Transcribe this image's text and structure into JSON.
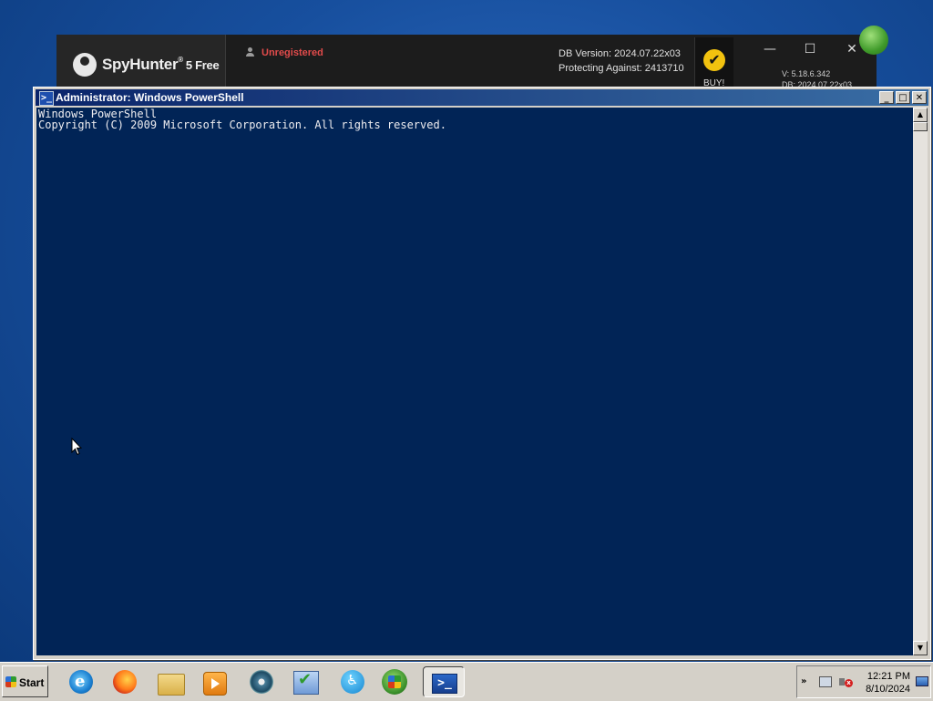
{
  "spyhunter": {
    "logo_name": "SpyHunter",
    "logo_reg": "®",
    "logo_edition": "5 Free",
    "user_status": "Unregistered",
    "db_version": "DB Version: 2024.07.22x03",
    "protecting_against": "Protecting Against: 2413710",
    "buy_label": "BUY!",
    "buy_icon": "✔",
    "minimize": "—",
    "maximize": "☐",
    "close": "✕",
    "version": "V: 5.18.6.342",
    "db_short": "DB: 2024.07.22x03",
    "accent_color": "#f2c20f",
    "status_color": "#e24b4b"
  },
  "powershell": {
    "title": "Administrator: Windows PowerShell",
    "title_icon": ">_",
    "buttons": {
      "minimize": "_",
      "maximize": "□",
      "close": "✕"
    },
    "console_lines": [
      "Windows PowerShell",
      "Copyright (C) 2009 Microsoft Corporation. All rights reserved."
    ],
    "console_bg": "#012456",
    "scroll_up": "▲",
    "scroll_down": "▼"
  },
  "taskbar": {
    "start_label": "Start",
    "pinned": [
      {
        "name": "internet-explorer-icon",
        "glyph": "e"
      },
      {
        "name": "firefox-icon"
      },
      {
        "name": "file-explorer-icon"
      },
      {
        "name": "media-player-icon"
      },
      {
        "name": "cd-burner-icon"
      },
      {
        "name": "checklist-app-icon",
        "glyph": "✔"
      },
      {
        "name": "accessibility-icon",
        "glyph": "♿"
      },
      {
        "name": "windows-orb-icon"
      },
      {
        "name": "powershell-taskbar-icon",
        "glyph": ">_"
      }
    ],
    "tray": {
      "chevron": "»",
      "time": "12:21 PM",
      "date": "8/10/2024",
      "mute_glyph": "x"
    }
  }
}
